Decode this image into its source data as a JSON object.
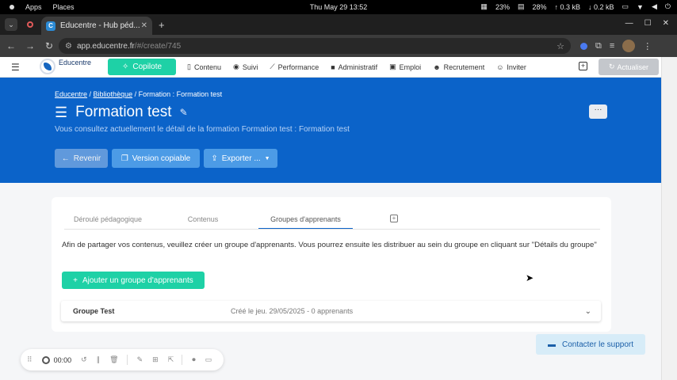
{
  "os": {
    "apps": "Apps",
    "places": "Places",
    "datetime": "Thu May 29  13:52",
    "cpu": "23%",
    "mem": "28%",
    "up": "↑ 0.3 kB",
    "down": "↓ 0.2 kB"
  },
  "browser": {
    "tab_title": "Educentre - Hub péd...",
    "url_host": "app.educentre.fr",
    "url_path": "/#/create/745"
  },
  "appbar": {
    "logo_text": "Educentre",
    "copilote": "Copilote",
    "menu": [
      {
        "icon": "doc-icon",
        "label": "Contenu"
      },
      {
        "icon": "check-circle-icon",
        "label": "Suivi"
      },
      {
        "icon": "chart-line-icon",
        "label": "Performance"
      },
      {
        "icon": "briefcase-icon",
        "label": "Administratif"
      },
      {
        "icon": "suitcase-icon",
        "label": "Emploi"
      },
      {
        "icon": "users-icon",
        "label": "Recrutement"
      },
      {
        "icon": "user-plus-icon",
        "label": "Inviter"
      }
    ],
    "actualiser": "Actualiser"
  },
  "hero": {
    "crumb_1": "Educentre",
    "crumb_sep_1": " / ",
    "crumb_2": "Bibliothèque",
    "crumb_sep_2": " / ",
    "crumb_3": "Formation : Formation test",
    "title": "Formation test",
    "subtitle": "Vous consultez actuellement le détail de la formation Formation test : Formation test",
    "more": "···",
    "btn_revenir": "Revenir",
    "btn_version": "Version copiable",
    "btn_export": "Exporter ..."
  },
  "card": {
    "tabs": [
      "Déroulé pédagogique",
      "Contenus",
      "Groupes d'apprenants"
    ],
    "info": "Afin de partager vos contenus, veuillez créer un groupe d'apprenants. Vous pourrez ensuite les distribuer au sein du groupe en cliquant sur \"Détails du groupe\"",
    "add_group": "Ajouter un groupe d'apprenants",
    "group": {
      "name": "Groupe Test",
      "created": "Créé le jeu. 29/05/2025 - 0 apprenants"
    }
  },
  "support": "Contacter le support",
  "recorder": {
    "time": "00:00"
  },
  "colors": {
    "primary_blue": "#0b63c9",
    "accent_green": "#1ed1a6"
  }
}
